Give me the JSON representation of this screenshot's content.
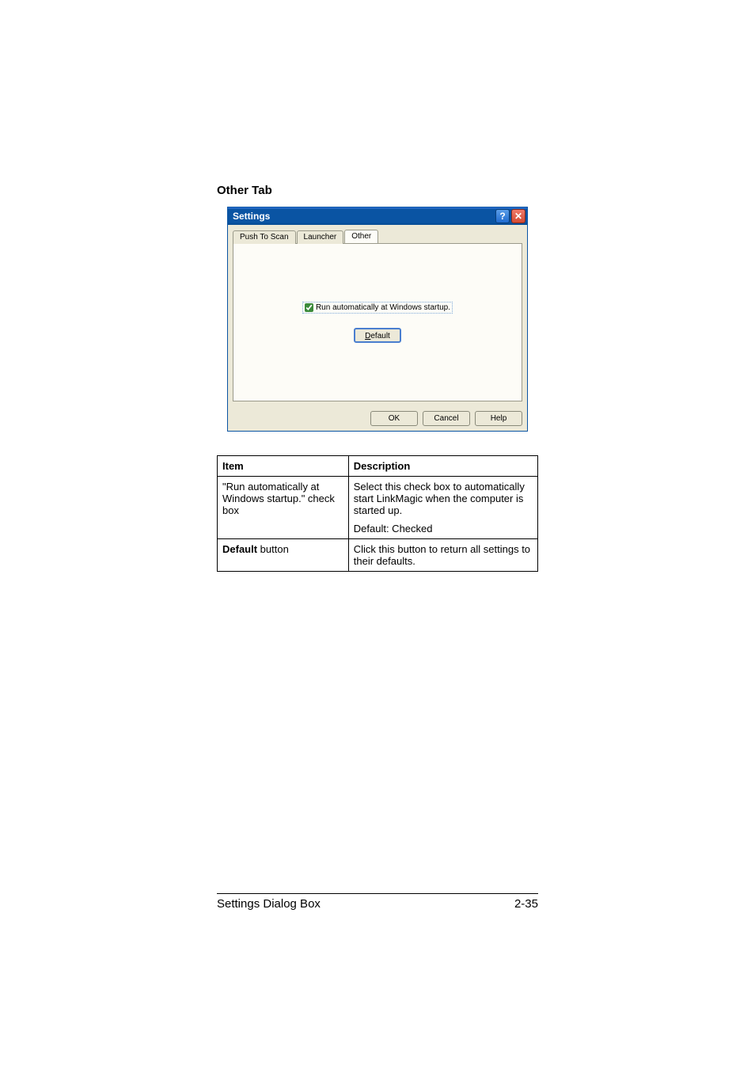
{
  "heading": "Other Tab",
  "dialog": {
    "title": "Settings",
    "help_glyph": "?",
    "close_glyph": "✕",
    "tabs": [
      "Push To Scan",
      "Launcher",
      "Other"
    ],
    "active_tab": 2,
    "checkbox_label": "Run automatically at Windows startup.",
    "checkbox_checked": true,
    "default_button": "Default",
    "buttons": [
      "OK",
      "Cancel",
      "Help"
    ]
  },
  "table": {
    "headers": [
      "Item",
      "Description"
    ],
    "rows": [
      {
        "item": "\"Run automatically at Windows startup.\" check box",
        "item_bold": false,
        "desc": [
          "Select this check box to automatically start LinkMagic when the computer is started up.",
          "Default: Checked"
        ]
      },
      {
        "item": "Default button",
        "item_bold_part": "Default",
        "item_rest": " button",
        "desc": [
          "Click this button to return all settings to their defaults."
        ]
      }
    ]
  },
  "footer": {
    "left": "Settings Dialog Box",
    "right": "2-35"
  }
}
